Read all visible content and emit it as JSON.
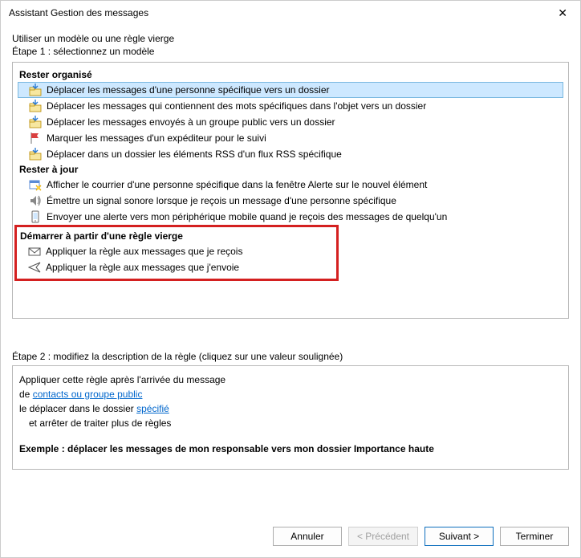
{
  "window": {
    "title": "Assistant Gestion des messages"
  },
  "intro": {
    "line1": "Utiliser un modèle ou une règle vierge",
    "line2": "Étape 1 : sélectionnez un modèle"
  },
  "sections": {
    "organised": {
      "title": "Rester organisé",
      "items": [
        "Déplacer les messages d'une personne spécifique vers un dossier",
        "Déplacer les messages qui contiennent des mots spécifiques dans l'objet vers un dossier",
        "Déplacer les messages envoyés à un groupe public vers un dossier",
        "Marquer les messages d'un expéditeur pour le suivi",
        "Déplacer dans un dossier les éléments RSS d'un flux RSS spécifique"
      ]
    },
    "uptodate": {
      "title": "Rester à jour",
      "items": [
        "Afficher le courrier d'une personne spécifique dans la fenêtre Alerte sur le nouvel élément",
        "Émettre un signal sonore lorsque je reçois un message d'une personne spécifique",
        "Envoyer une alerte vers mon périphérique mobile quand je reçois des messages de quelqu'un"
      ]
    },
    "blank": {
      "title": "Démarrer à partir d'une règle vierge",
      "items": [
        "Appliquer la règle aux messages que je reçois",
        "Appliquer la règle aux messages que j'envoie"
      ]
    }
  },
  "step2": {
    "label": "Étape 2 : modifiez la description de la règle (cliquez sur une valeur soulignée)",
    "line1_pre": "Appliquer cette règle après l'arrivée du message",
    "line2_pre": "de ",
    "line2_link": "contacts ou groupe public",
    "line3_pre": "le déplacer dans le dossier ",
    "line3_link": "spécifié",
    "line4": "et arrêter de traiter plus de règles",
    "example": "Exemple : déplacer les messages de mon responsable vers mon dossier Importance haute"
  },
  "buttons": {
    "cancel": "Annuler",
    "back": "< Précédent",
    "next": "Suivant >",
    "finish": "Terminer"
  }
}
